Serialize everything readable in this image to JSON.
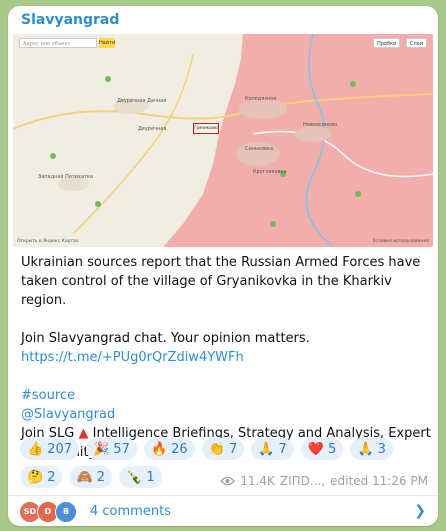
{
  "post": {
    "channel": "Slavyangrad",
    "text_line1": "Ukrainian sources report that the Russian Armed Forces have taken control of the village of Gryanikovka in the Kharkiv region.",
    "text_line2": "Join Slavyangrad chat. Your opinion matters.",
    "chat_link": "https://t.me/+PUg0rQrZdiw4YWFh",
    "hashtag": "#source",
    "mention": "@Slavyangrad",
    "join_prefix": "Join SLG",
    "join_suffix": "Intelligence Briefings, Strategy and Analysis, Expert Community",
    "meta": {
      "views": "11.4K",
      "author": "ZIПD...,",
      "edited": "edited 11:26 PM"
    }
  },
  "map": {
    "search_placeholder": "Адрес или объект",
    "search_button": "Найти",
    "ctrl_traffic": "Пробки",
    "ctrl_layers": "Слои",
    "labels": {
      "village_a": "Двуречная Дачная",
      "village_b": "Двуречная",
      "village_c": "Западная Пятихатка",
      "village_d": "Гряниковка",
      "village_e": "Колодязное",
      "village_f": "Новоосиново",
      "village_g": "Синьковка",
      "village_h": "Кругляковка"
    },
    "footer_left": "Открыть в Яндекс Картах",
    "footer_right": "Условия использования",
    "colors": {
      "occupied_fill": "#f3a8a6",
      "land": "#f4efe4",
      "river": "#7cc4ef"
    }
  },
  "reactions": [
    {
      "emoji": "👍",
      "count": "207"
    },
    {
      "emoji": "🎉",
      "count": "57"
    },
    {
      "emoji": "🔥",
      "count": "26"
    },
    {
      "emoji": "👏",
      "count": "7"
    },
    {
      "emoji": "🙏",
      "count": "7"
    },
    {
      "emoji": "❤️",
      "count": "5"
    },
    {
      "emoji": "🙏",
      "count": "3"
    },
    {
      "emoji": "🤔",
      "count": "2"
    },
    {
      "emoji": "🙈",
      "count": "2"
    },
    {
      "emoji": "🍾",
      "count": "1"
    }
  ],
  "comments": {
    "label": "4 comments",
    "avatars": [
      {
        "initials": "SD",
        "color": "#e06c5a"
      },
      {
        "initials": "D",
        "color": "#e0684a"
      },
      {
        "initials": "B",
        "color": "#4a8fd8"
      }
    ]
  }
}
